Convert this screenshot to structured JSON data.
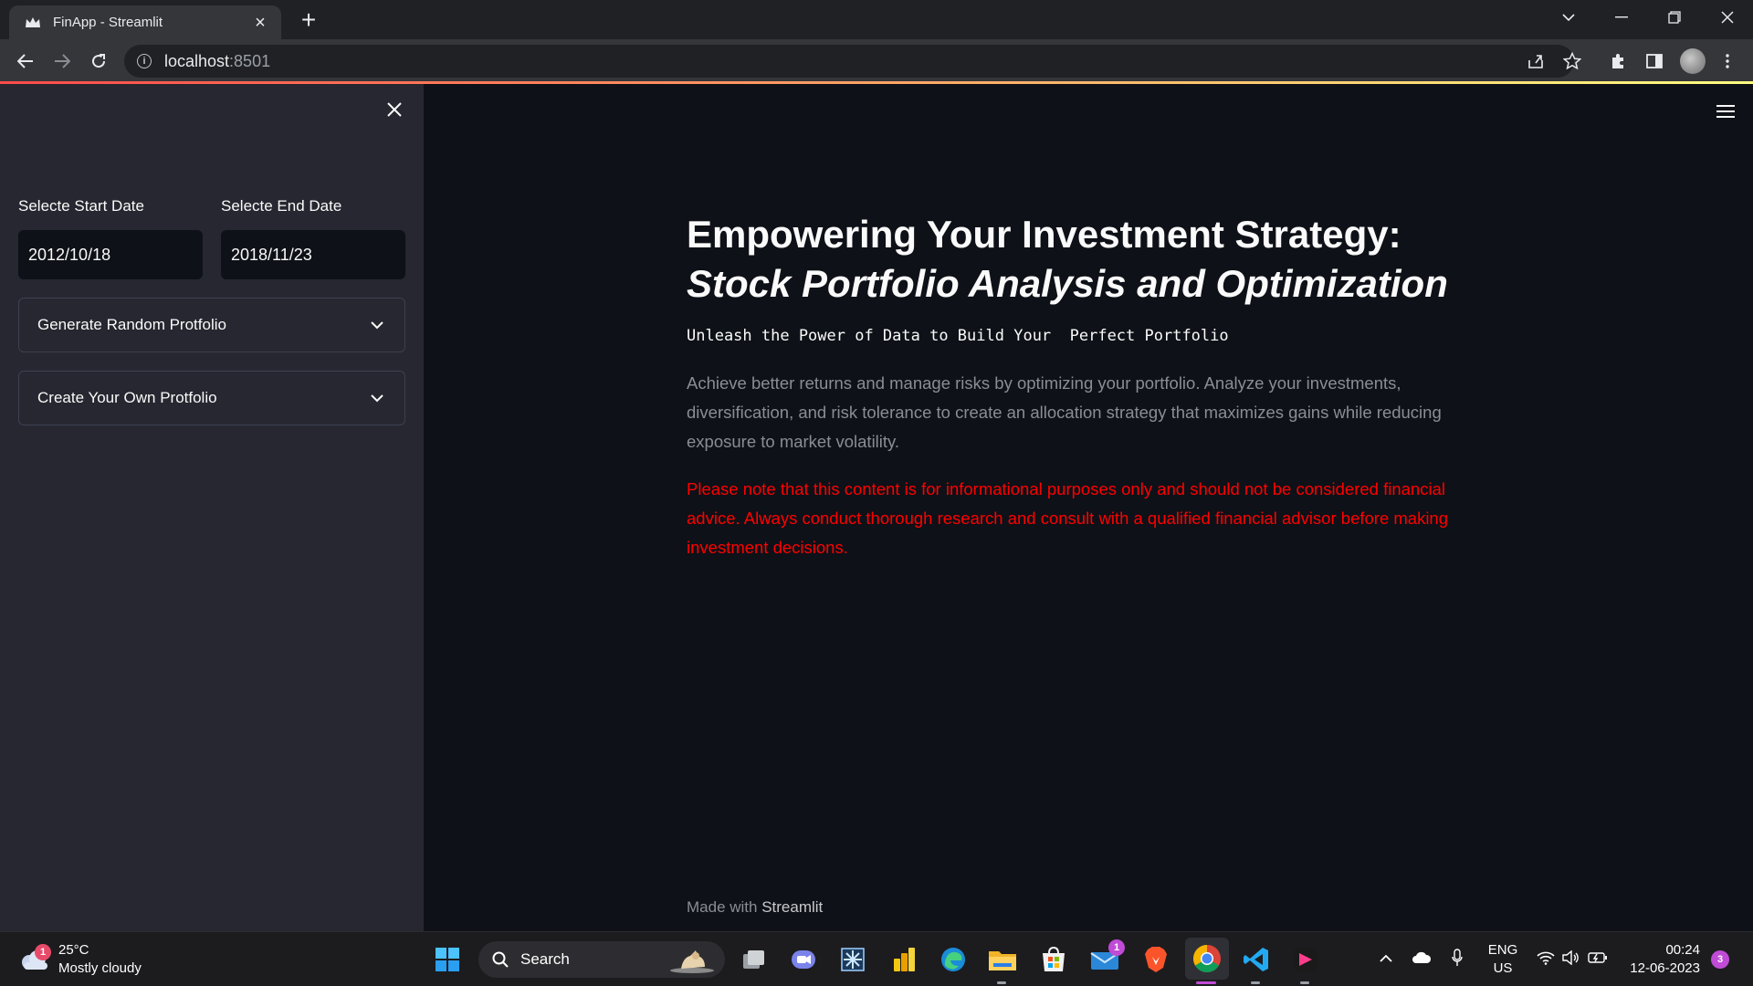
{
  "browser": {
    "tab_title": "FinApp - Streamlit",
    "url_host": "localhost",
    "url_port": ":8501"
  },
  "sidebar": {
    "start_date_label": "Selecte Start Date",
    "start_date_value": "2012/10/18",
    "end_date_label": "Selecte End Date",
    "end_date_value": "2018/11/23",
    "expanders": [
      {
        "label": "Generate Random Protfolio"
      },
      {
        "label": "Create Your Own Protfolio"
      }
    ]
  },
  "main": {
    "headline_plain": "Empowering Your Investment Strategy: ",
    "headline_italic": "Stock Portfolio Analysis and Optimization",
    "subheading": "Unleash the Power of Data to Build Your  Perfect Portfolio",
    "description": "Achieve better returns and manage risks by optimizing your portfolio. Analyze your investments, diversification, and risk tolerance to create an allocation strategy that maximizes gains while reducing exposure to market volatility.",
    "disclaimer": "Please note that this content is for informational purposes only and should not be considered financial advice. Always conduct thorough research and consult with a qualified financial advisor before making investment decisions.",
    "footer_prefix": "Made with ",
    "footer_brand": "Streamlit"
  },
  "taskbar": {
    "weather_badge": "1",
    "temperature": "25°C",
    "weather_desc": "Mostly cloudy",
    "search_label": "Search",
    "mail_badge": "1",
    "lang_line1": "ENG",
    "lang_line2": "US",
    "time": "00:24",
    "date": "12-06-2023",
    "notification_count": "3"
  },
  "colors": {
    "accent_red": "#ff4b4b",
    "disclaimer_red": "#ff0000",
    "sidebar_bg": "#262730",
    "main_bg": "#0e1117"
  }
}
